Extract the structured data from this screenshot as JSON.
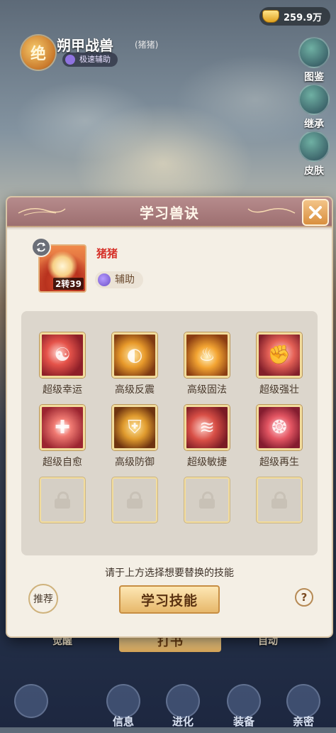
{
  "currency": {
    "amount": "259.9万",
    "icon": "gold-ingot-icon"
  },
  "pet": {
    "grade": "绝",
    "title": "朔甲战兽",
    "nickname": "(猪猪)",
    "type": "极速辅助"
  },
  "side_menu": [
    {
      "label": "图鉴",
      "icon": "book-icon"
    },
    {
      "label": "继承",
      "icon": "inherit-icon"
    },
    {
      "label": "皮肤",
      "icon": "skin-icon"
    }
  ],
  "under_buttons": {
    "awaken": "觉醒",
    "write_book": "打书",
    "auto": "自动"
  },
  "bottom_nav": [
    {
      "label": "信息",
      "icon": "info-icon"
    },
    {
      "label": "进化",
      "icon": "evolve-icon"
    },
    {
      "label": "装备",
      "icon": "equipment-icon"
    },
    {
      "label": "亲密",
      "icon": "intimacy-icon"
    }
  ],
  "dialog": {
    "title": "学习兽诀",
    "pet_name": "猪猪",
    "pet_level": "2转39",
    "role": "辅助",
    "skills": [
      {
        "label": "超级幸运",
        "icon": "fish-luck-icon"
      },
      {
        "label": "高级反震",
        "icon": "shield-counter-icon"
      },
      {
        "label": "高级固法",
        "icon": "fire-shield-icon"
      },
      {
        "label": "超级强壮",
        "icon": "muscle-arm-icon"
      },
      {
        "label": "超级自愈",
        "icon": "heal-cross-icon"
      },
      {
        "label": "高级防御",
        "icon": "defense-shield-icon"
      },
      {
        "label": "超级敏捷",
        "icon": "speed-claw-icon"
      },
      {
        "label": "超级再生",
        "icon": "regen-beast-icon"
      }
    ],
    "locked_slots": 4,
    "hint": "请于上方选择想要替换的技能",
    "recommend_label": "推荐",
    "learn_button": "学习技能",
    "help_label": "?"
  },
  "colors": {
    "header": "#9d6f70",
    "panel": "#f4efe5",
    "pet_name": "#d6322a",
    "button_gold": "#e7b86b"
  }
}
